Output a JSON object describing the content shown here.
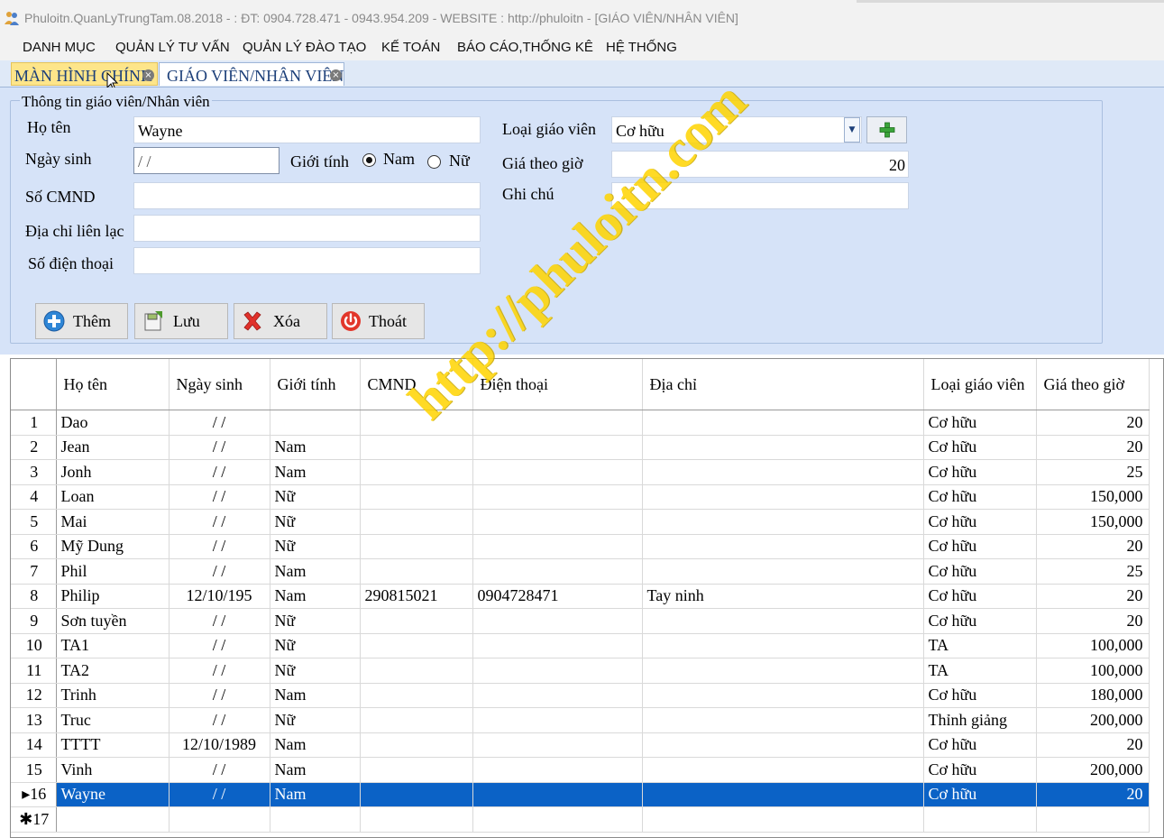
{
  "window": {
    "title": "Phuloitn.QuanLyTrungTam.08.2018 - : ĐT: 0904.728.471 - 0943.954.209 - WEBSITE : http://phuloitn - [GIÁO VIÊN/NHÂN VIÊN]"
  },
  "menu": [
    "DANH MỤC",
    "QUẢN LÝ TƯ VẤN",
    "QUẢN LÝ ĐÀO TẠO",
    "KẾ TOÁN",
    "BÁO CÁO,THỐNG KÊ",
    "HỆ THỐNG"
  ],
  "tabs": [
    {
      "label": "MÀN HÌNH CHÍNH",
      "active": false
    },
    {
      "label": "GIÁO VIÊN/NHÂN VIÊN",
      "active": true
    }
  ],
  "form": {
    "group_title": "Thông tin giáo viên/Nhân viên",
    "ho_ten_label": "Họ tên",
    "ho_ten_value": "Wayne",
    "ngay_sinh_label": "Ngày sinh",
    "ngay_sinh_value": " / /",
    "gioi_tinh_label": "Giới tính",
    "gioi_tinh_options": [
      "Nam",
      "Nữ"
    ],
    "gioi_tinh_selected": "Nam",
    "cmnd_label": "Số CMND",
    "cmnd_value": "",
    "dia_chi_label": "Địa chỉ liên lạc",
    "dia_chi_value": "",
    "dien_thoai_label": "Số điện thoại",
    "dien_thoai_value": "",
    "loai_gv_label": "Loại giáo viên",
    "loai_gv_value": "Cơ hữu",
    "gia_label": "Giá theo giờ",
    "gia_value": "20",
    "ghi_chu_label": "Ghi chú",
    "ghi_chu_value": ""
  },
  "buttons": {
    "them": "Thêm",
    "luu": "Lưu",
    "xoa": "Xóa",
    "thoat": "Thoát"
  },
  "icons": {
    "app": "people-icon",
    "add_type": "plus-icon",
    "them": "plus-circle-icon",
    "luu": "save-icon",
    "xoa": "delete-x-icon",
    "thoat": "power-icon"
  },
  "colors": {
    "panel_bg": "#d6e3f8",
    "tab_active_bg": "#fde58a",
    "selection": "#0b62c6",
    "watermark": "#ffd400"
  },
  "grid": {
    "columns": [
      "Họ tên",
      "Ngày sinh",
      "Giới tính",
      "CMND",
      "Điện thoại",
      "Địa chỉ",
      "Loại giáo viên",
      "Giá theo giờ"
    ],
    "rows": [
      {
        "no": "1",
        "ho_ten": "Dao",
        "ngay_sinh": " / /",
        "gioi_tinh": "",
        "cmnd": "",
        "dien_thoai": "",
        "dia_chi": "",
        "loai": "Cơ hữu",
        "gia": "20"
      },
      {
        "no": "2",
        "ho_ten": "Jean",
        "ngay_sinh": " / /",
        "gioi_tinh": "Nam",
        "cmnd": "",
        "dien_thoai": "",
        "dia_chi": "",
        "loai": "Cơ hữu",
        "gia": "20"
      },
      {
        "no": "3",
        "ho_ten": "Jonh",
        "ngay_sinh": " / /",
        "gioi_tinh": "Nam",
        "cmnd": "",
        "dien_thoai": "",
        "dia_chi": "",
        "loai": "Cơ hữu",
        "gia": "25"
      },
      {
        "no": "4",
        "ho_ten": "Loan",
        "ngay_sinh": " / /",
        "gioi_tinh": "Nữ",
        "cmnd": "",
        "dien_thoai": "",
        "dia_chi": "",
        "loai": "Cơ hữu",
        "gia": "150,000"
      },
      {
        "no": "5",
        "ho_ten": "Mai",
        "ngay_sinh": " / /",
        "gioi_tinh": "Nữ",
        "cmnd": "",
        "dien_thoai": "",
        "dia_chi": "",
        "loai": "Cơ hữu",
        "gia": "150,000"
      },
      {
        "no": "6",
        "ho_ten": "Mỹ Dung",
        "ngay_sinh": " / /",
        "gioi_tinh": "Nữ",
        "cmnd": "",
        "dien_thoai": "",
        "dia_chi": "",
        "loai": "Cơ hữu",
        "gia": "20"
      },
      {
        "no": "7",
        "ho_ten": "Phil",
        "ngay_sinh": " / /",
        "gioi_tinh": "Nam",
        "cmnd": "",
        "dien_thoai": "",
        "dia_chi": "",
        "loai": "Cơ hữu",
        "gia": "25"
      },
      {
        "no": "8",
        "ho_ten": "Philip",
        "ngay_sinh": "12/10/195",
        "gioi_tinh": "Nam",
        "cmnd": "290815021",
        "dien_thoai": "0904728471",
        "dia_chi": "Tay ninh",
        "loai": "Cơ hữu",
        "gia": "20"
      },
      {
        "no": "9",
        "ho_ten": "Sơn tuyền",
        "ngay_sinh": " / /",
        "gioi_tinh": "Nữ",
        "cmnd": "",
        "dien_thoai": "",
        "dia_chi": "",
        "loai": "Cơ hữu",
        "gia": "20"
      },
      {
        "no": "10",
        "ho_ten": "TA1",
        "ngay_sinh": " / /",
        "gioi_tinh": "Nữ",
        "cmnd": "",
        "dien_thoai": "",
        "dia_chi": "",
        "loai": "TA",
        "gia": "100,000"
      },
      {
        "no": "11",
        "ho_ten": "TA2",
        "ngay_sinh": " / /",
        "gioi_tinh": "Nữ",
        "cmnd": "",
        "dien_thoai": "",
        "dia_chi": "",
        "loai": "TA",
        "gia": "100,000"
      },
      {
        "no": "12",
        "ho_ten": "Trinh",
        "ngay_sinh": " / /",
        "gioi_tinh": "Nam",
        "cmnd": "",
        "dien_thoai": "",
        "dia_chi": "",
        "loai": "Cơ hữu",
        "gia": "180,000"
      },
      {
        "no": "13",
        "ho_ten": "Truc",
        "ngay_sinh": " / /",
        "gioi_tinh": "Nữ",
        "cmnd": "",
        "dien_thoai": "",
        "dia_chi": "",
        "loai": "Thỉnh giảng",
        "gia": "200,000"
      },
      {
        "no": "14",
        "ho_ten": "TTTT",
        "ngay_sinh": "12/10/1989",
        "gioi_tinh": "Nam",
        "cmnd": "",
        "dien_thoai": "",
        "dia_chi": "",
        "loai": "Cơ hữu",
        "gia": "20"
      },
      {
        "no": "15",
        "ho_ten": "Vinh",
        "ngay_sinh": " / /",
        "gioi_tinh": "Nam",
        "cmnd": "",
        "dien_thoai": "",
        "dia_chi": "",
        "loai": "Cơ hữu",
        "gia": "200,000"
      },
      {
        "no": "▸16",
        "ho_ten": "Wayne",
        "ngay_sinh": " / /",
        "gioi_tinh": "Nam",
        "cmnd": "",
        "dien_thoai": "",
        "dia_chi": "",
        "loai": "Cơ hữu",
        "gia": "20",
        "selected": true
      },
      {
        "no": "✱17",
        "ho_ten": "",
        "ngay_sinh": "",
        "gioi_tinh": "",
        "cmnd": "",
        "dien_thoai": "",
        "dia_chi": "",
        "loai": "",
        "gia": ""
      }
    ]
  },
  "watermark": "http://phuloitn.com"
}
